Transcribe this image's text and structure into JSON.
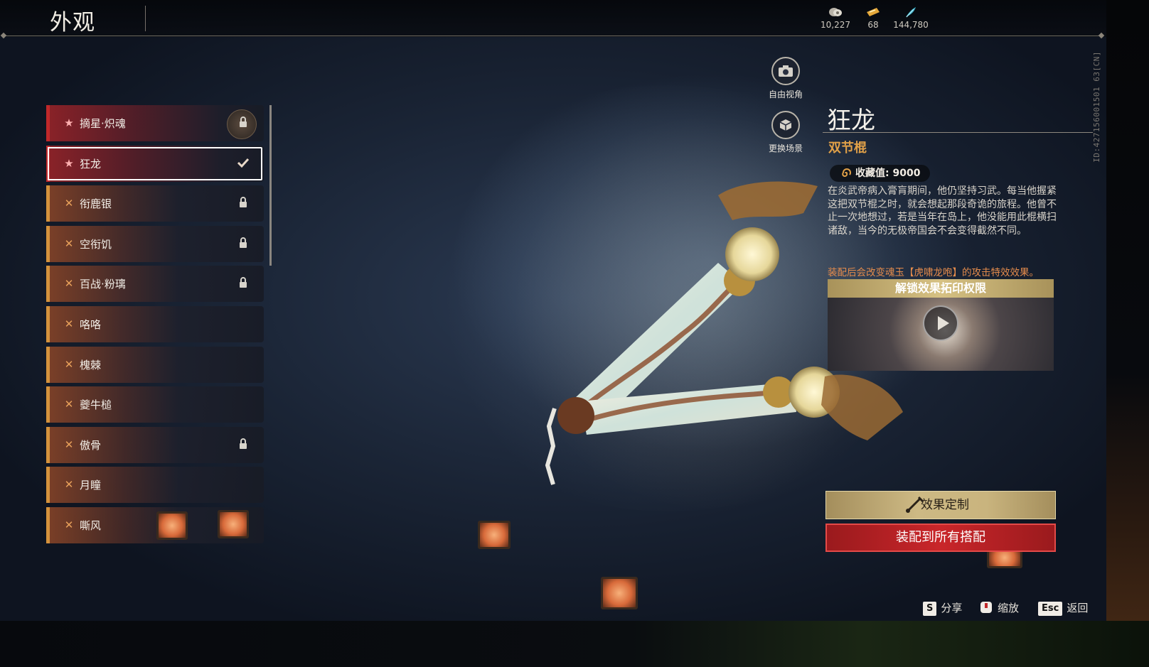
{
  "header": {
    "title": "外观",
    "currencies": [
      {
        "icon": "coin-icon",
        "value": "10,227"
      },
      {
        "icon": "ticket-icon",
        "value": "68"
      },
      {
        "icon": "feather-icon",
        "value": "144,780"
      }
    ]
  },
  "list": {
    "items": [
      {
        "name": "摘星·炽魂",
        "mark": "★",
        "status": "locked"
      },
      {
        "name": "狂龙",
        "mark": "★",
        "status": "equipped"
      },
      {
        "name": "衔鹿银",
        "mark": "✕",
        "status": "locked"
      },
      {
        "name": "空衔饥",
        "mark": "✕",
        "status": "locked"
      },
      {
        "name": "百战·粉璃",
        "mark": "✕",
        "status": "locked"
      },
      {
        "name": "咯咯",
        "mark": "✕",
        "status": "none"
      },
      {
        "name": "槐棘",
        "mark": "✕",
        "status": "none"
      },
      {
        "name": "夔牛槌",
        "mark": "✕",
        "status": "none"
      },
      {
        "name": "傲骨",
        "mark": "✕",
        "status": "locked"
      },
      {
        "name": "月瞳",
        "mark": "✕",
        "status": "none"
      },
      {
        "name": "嘶风",
        "mark": "✕",
        "status": "none"
      }
    ]
  },
  "camera": {
    "free_view": "自由视角",
    "change_scene": "更换场景"
  },
  "side_id": "ID:427156001501 63[CN]",
  "detail": {
    "name": "狂龙",
    "type": "双节棍",
    "collect_label": "收藏值: 9000",
    "description": "在炎武帝病入膏肓期间，他仍坚持习武。每当他握紧这把双节棍之时，就会想起那段奇诡的旅程。他曾不止一次地想过，若是当年在岛上，他没能用此棍横扫诸敌，当今的无极帝国会不会变得截然不同。",
    "equip_note": "装配后会改变魂玉【虎啸龙咆】的攻击特效效果。",
    "unlock_title": "解锁效果拓印权限"
  },
  "buttons": {
    "customize": "效果定制",
    "equip_all": "装配到所有搭配"
  },
  "hints": [
    {
      "key": "S",
      "label": "分享"
    },
    {
      "key": "",
      "label": "缩放"
    },
    {
      "key": "Esc",
      "label": "返回"
    }
  ],
  "colors": {
    "accent_gold": "#e0a048",
    "equip_red": "#c9262a",
    "note_orange": "#e58c4c"
  }
}
